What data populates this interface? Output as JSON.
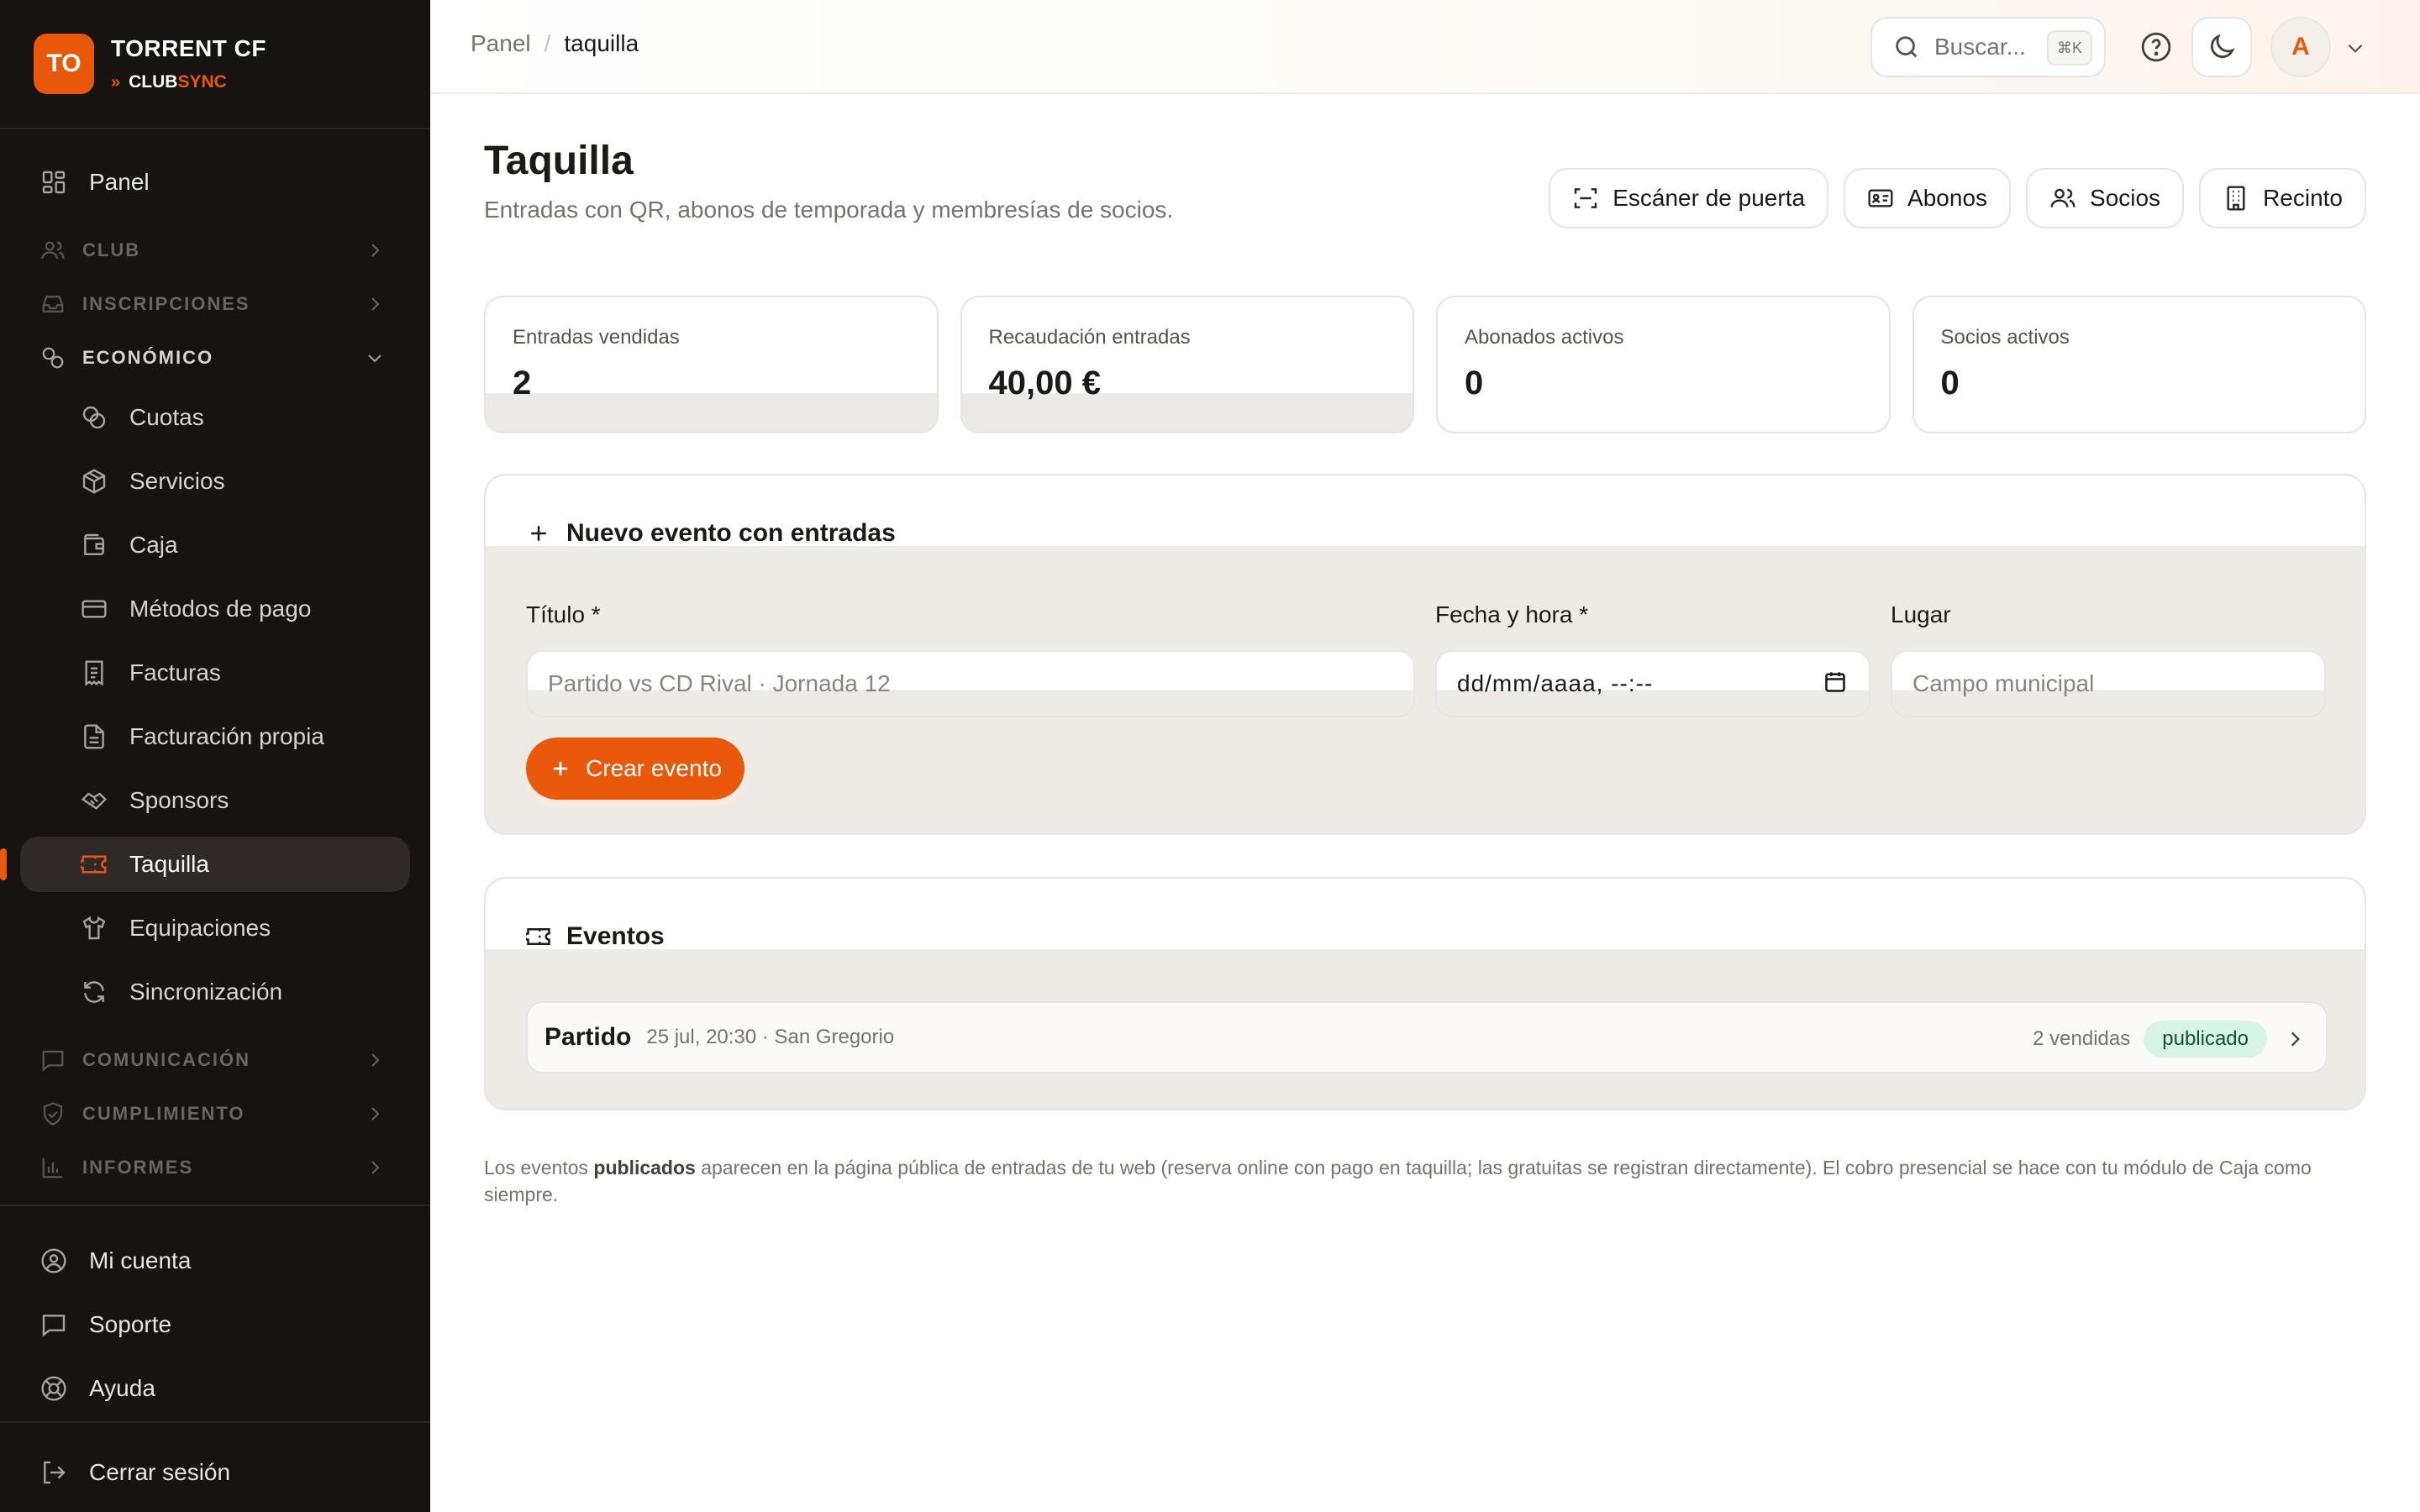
{
  "brand": {
    "logo": "TO",
    "name": "TORRENT CF",
    "sub_prefix": "CLUB",
    "sub_suffix": "SYNC",
    "accent": "#ea580c"
  },
  "sidebar": {
    "panel": "Panel",
    "sections": {
      "club": "CLUB",
      "inscripciones": "INSCRIPCIONES",
      "economico": "ECONÓMICO",
      "comunicacion": "COMUNICACIÓN",
      "cumplimiento": "CUMPLIMIENTO",
      "informes": "INFORMES"
    },
    "economico_items": [
      "Cuotas",
      "Servicios",
      "Caja",
      "Métodos de pago",
      "Facturas",
      "Facturación propia",
      "Sponsors",
      "Taquilla",
      "Equipaciones",
      "Sincronización"
    ],
    "active": "Taquilla",
    "bottom": {
      "cuenta": "Mi cuenta",
      "soporte": "Soporte",
      "ayuda": "Ayuda",
      "logout": "Cerrar sesión"
    }
  },
  "topbar": {
    "breadcrumb": {
      "root": "Panel",
      "sep": "/",
      "current": "taquilla"
    },
    "search": {
      "placeholder": "Buscar...",
      "shortcut": "⌘K"
    },
    "avatar": "A"
  },
  "page": {
    "title": "Taquilla",
    "subtitle": "Entradas con QR, abonos de temporada y membresías de socios.",
    "actions": {
      "scanner": "Escáner de puerta",
      "abonos": "Abonos",
      "socios": "Socios",
      "recinto": "Recinto"
    }
  },
  "stats": [
    {
      "label": "Entradas vendidas",
      "value": "2"
    },
    {
      "label": "Recaudación entradas",
      "value": "40,00 €"
    },
    {
      "label": "Abonados activos",
      "value": "0"
    },
    {
      "label": "Socios activos",
      "value": "0"
    }
  ],
  "new_event": {
    "title": "Nuevo evento con entradas",
    "titulo_label": "Título *",
    "titulo_placeholder": "Partido vs CD Rival · Jornada 12",
    "fecha_label": "Fecha y hora *",
    "fecha_value": "dd/mm/aaaa, --:--",
    "lugar_label": "Lugar",
    "lugar_placeholder": "Campo municipal",
    "submit": "Crear evento"
  },
  "events": {
    "title": "Eventos",
    "items": [
      {
        "name": "Partido",
        "meta": "25 jul, 20:30 · San Gregorio",
        "sold": "2 vendidas",
        "status": "publicado"
      }
    ]
  },
  "footer": {
    "pre": "Los eventos ",
    "bold": "publicados",
    "post": " aparecen en la página pública de entradas de tu web (reserva online con pago en taquilla; las gratuitas se registran directamente). El cobro presencial se hace con tu módulo de Caja como siempre."
  }
}
